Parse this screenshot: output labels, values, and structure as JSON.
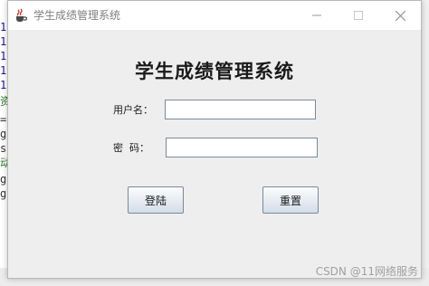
{
  "window": {
    "title": "学生成绩管理系统",
    "app_icon": "java-cup-icon",
    "controls": {
      "minimize": "minimize-icon",
      "maximize": "maximize-icon",
      "close": "close-icon"
    }
  },
  "form": {
    "heading": "学生成绩管理系统",
    "username_label": "用户名：",
    "username_value": "",
    "password_label": "密  码：",
    "password_value": "",
    "login_button": "登陆",
    "reset_button": "重置"
  },
  "background": {
    "code_lines": [
      "1",
      "1",
      "1",
      "1",
      "1",
      "资",
      "=",
      "g",
      "s",
      "动",
      "g",
      "g"
    ]
  },
  "watermark": "CSDN @11网络服务"
}
